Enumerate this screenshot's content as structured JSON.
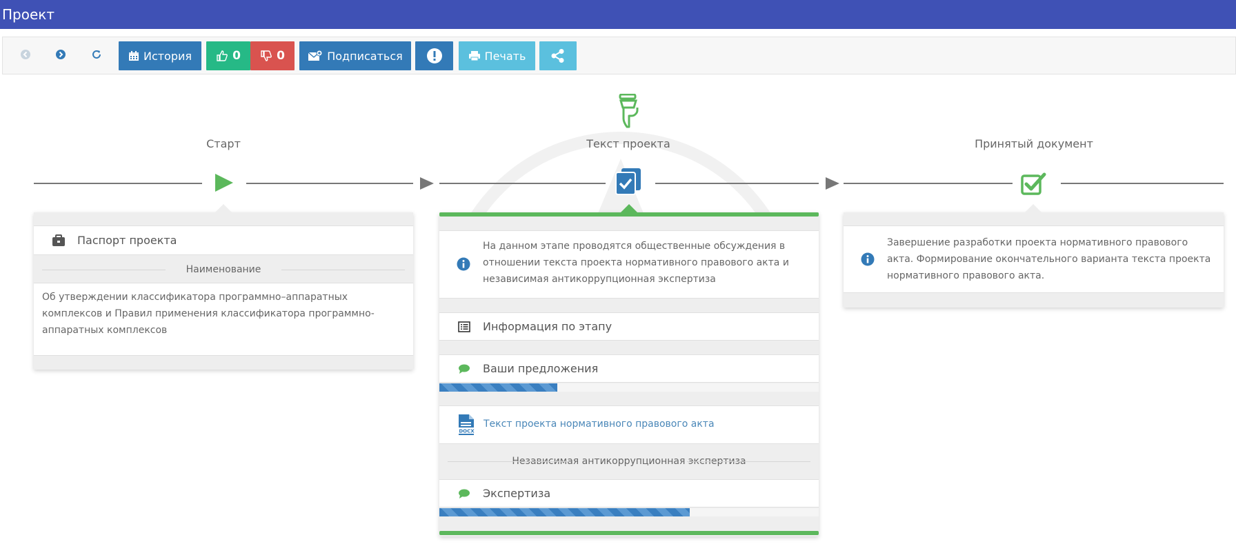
{
  "header": {
    "title": "Проект"
  },
  "toolbar": {
    "history_label": "История",
    "likes": "0",
    "dislikes": "0",
    "subscribe_label": "Подписаться",
    "print_label": "Печать"
  },
  "stages": {
    "start": {
      "title": "Старт",
      "passport_label": "Паспорт проекта",
      "name_heading": "Наименование",
      "name_text": "Об утверждении классификатора программно–аппаратных комплексов и Правил применения классификатора программно-аппаратных комплексов"
    },
    "text": {
      "title": "Текст проекта",
      "info_text": "На данном этапе проводятся общественные обсуждения в отношении текста проекта нормативного правового акта и независимая антикоррупционная экспертиза",
      "stage_info_label": "Информация по этапу",
      "proposals_label": "Ваши предложения",
      "proposals_progress": 0.31,
      "document_link": "Текст проекта нормативного правового акта",
      "doc_icon_text": "DOCX",
      "expertise_heading": "Независимая антикоррупционная экспертиза",
      "expertise_label": "Экспертиза",
      "expertise_progress": 0.66
    },
    "accepted": {
      "title": "Принятый документ",
      "info_text": "Завершение разработки проекта нормативного правового акта. Формирование окончательного варианта текста проекта нормативного правового акта."
    }
  },
  "colors": {
    "header": "#3f51b5",
    "primary": "#337ab7",
    "success": "#5cb85c",
    "like": "#26b986",
    "dislike": "#d9534f",
    "light": "#5bc0de"
  }
}
